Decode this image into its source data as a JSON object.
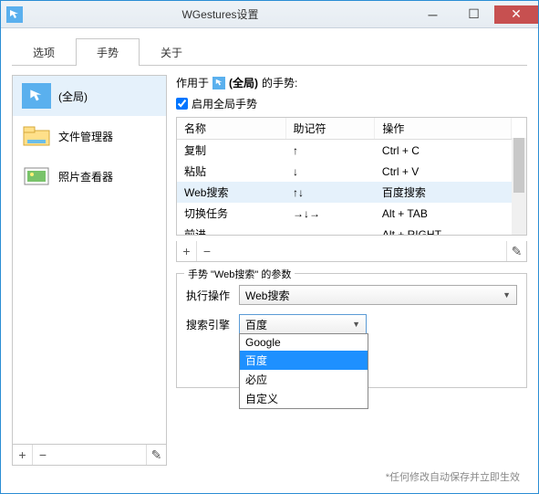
{
  "window": {
    "title": "WGestures设置"
  },
  "tabs": {
    "options": "选项",
    "gestures": "手势",
    "about": "关于"
  },
  "sidebar": {
    "items": [
      {
        "label": "(全局)"
      },
      {
        "label": "文件管理器"
      },
      {
        "label": "照片查看器"
      }
    ]
  },
  "applies": {
    "prefix": "作用于",
    "target": "(全局)",
    "suffix": "的手势:"
  },
  "enable": {
    "label": "启用全局手势",
    "checked": true
  },
  "table": {
    "headers": {
      "name": "名称",
      "mnemonic": "助记符",
      "action": "操作"
    },
    "rows": [
      {
        "name": "复制",
        "mnemonic": "↑",
        "action": "Ctrl + C"
      },
      {
        "name": "粘贴",
        "mnemonic": "↓",
        "action": "Ctrl + V"
      },
      {
        "name": "Web搜索",
        "mnemonic": "↑↓",
        "action": "百度搜索"
      },
      {
        "name": "切换任务",
        "mnemonic": "→↓→",
        "action": "Alt + TAB"
      },
      {
        "name": "前进",
        "mnemonic": "→",
        "action": "Alt + RIGHT"
      }
    ]
  },
  "params": {
    "title": "手势 \"Web搜索\" 的参数",
    "action_label": "执行操作",
    "action_value": "Web搜索",
    "engine_label": "搜索引擎",
    "engine_value": "百度",
    "engine_options": [
      "Google",
      "百度",
      "必应",
      "自定义"
    ]
  },
  "buttons": {
    "add": "+",
    "remove": "−",
    "edit": "✎"
  },
  "footer": "*任何修改自动保存并立即生效"
}
